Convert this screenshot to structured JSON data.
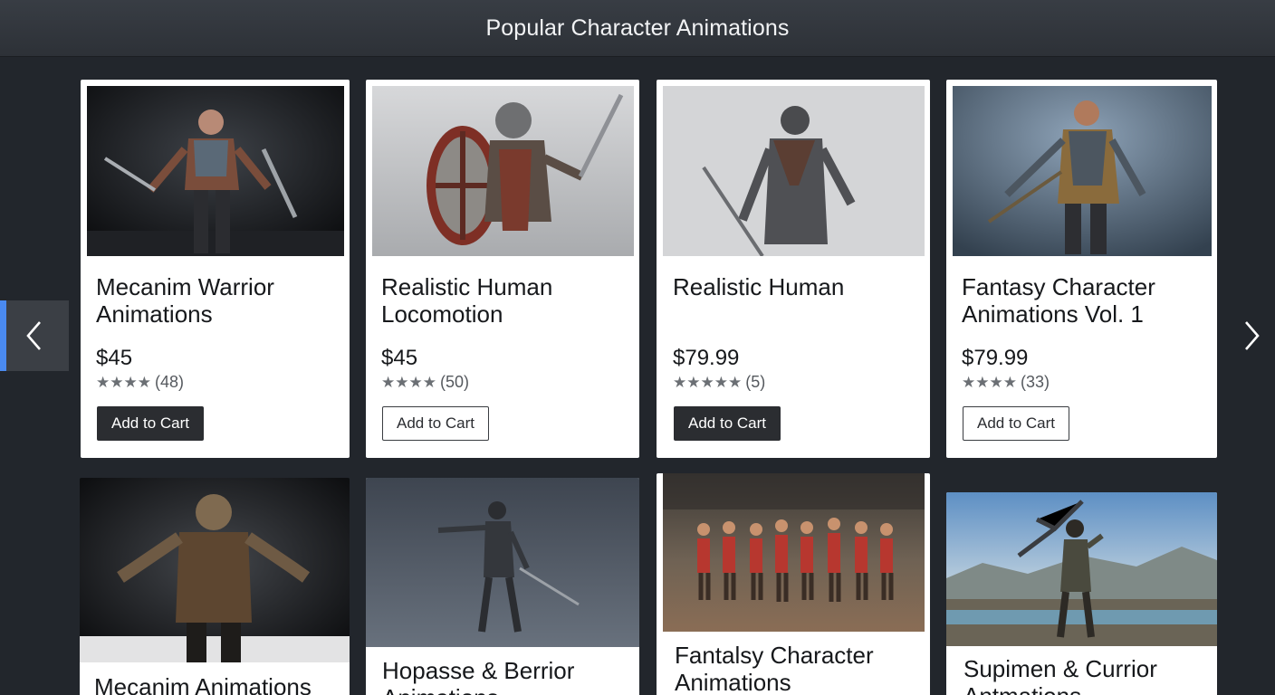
{
  "header": {
    "title": "Popular Character Animations"
  },
  "nav": {
    "prev_icon": "chevron-left-icon",
    "next_icon": "chevron-right-icon",
    "accent": "#4a8af0"
  },
  "products": [
    {
      "title": "Mecanim Warrior Animations",
      "price": "$45",
      "rating_count": "(48)",
      "stars": "★★★★",
      "button": "Add to Cart",
      "button_style": "dark"
    },
    {
      "title": "Realistic Human Locomotion",
      "price": "$45",
      "rating_count": "(50)",
      "stars": "★★★★",
      "button": "Add to Cart",
      "button_style": "light"
    },
    {
      "title": "Realistic Human",
      "price": "$79.99",
      "rating_count": "(5)",
      "stars": "★★★★★",
      "button": "Add to Cart",
      "button_style": "dark"
    },
    {
      "title": "Fantasy Character Animations Vol. 1",
      "price": "$79.99",
      "rating_count": "(33)",
      "stars": "★★★★",
      "button": "Add to Cart",
      "button_style": "light"
    },
    {
      "title": "Mecanim Animations"
    },
    {
      "title": "Hopasse & Berrior Animations"
    },
    {
      "title": "Fantalsy Character Animations"
    },
    {
      "title": "Supimen & Currior Antmations"
    }
  ]
}
